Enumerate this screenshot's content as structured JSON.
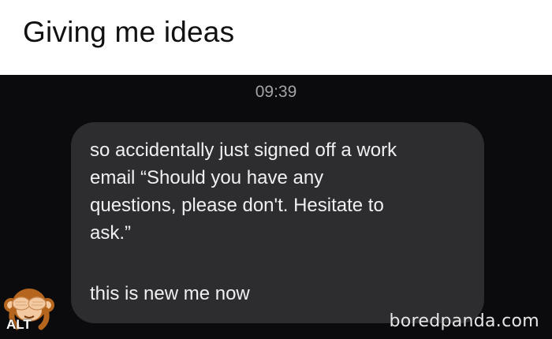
{
  "caption": {
    "title": "Giving me ideas"
  },
  "chat": {
    "timestamp": "09:39",
    "message_1": "so accidentally just signed off a work\nemail “Should you have any\nquestions, please don't. Hesitate to\nask.”",
    "message_2": "this is new me now",
    "bubble_color": "#2d2d30",
    "background_color": "#0b0b0d"
  },
  "overlay": {
    "avatar_icon": "see-no-evil-monkey-icon",
    "alt_label": "ALT",
    "watermark": "boredpanda.com"
  }
}
